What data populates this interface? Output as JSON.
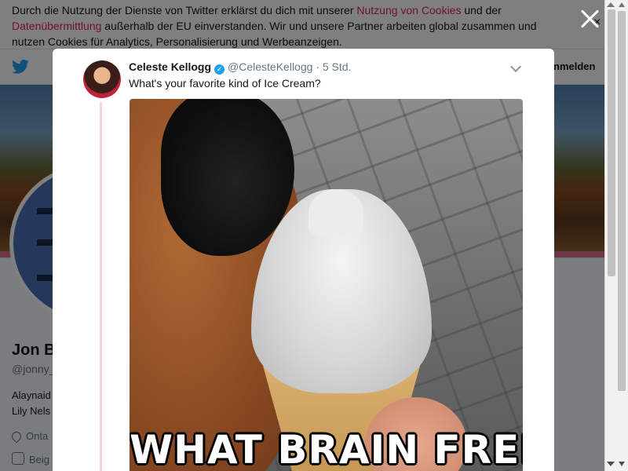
{
  "cookie_banner": {
    "text_1": "Durch die Nutzung der Dienste von Twitter erklärst du dich mit unserer ",
    "link_1": "Nutzung von Cookies",
    "text_2": " und der ",
    "link_2": "Datenübermittlung",
    "text_3": " außerhalb der EU einverstanden. Wir und unsere Partner arbeiten global zusammen und nutzen Cookies für Analytics, Personalisierung und Werbeanzeigen.",
    "close": "×"
  },
  "nav": {
    "logo_icon": "twitter-bird-icon",
    "login_label": "nmelden"
  },
  "profile": {
    "name": "Jon B",
    "handle": "@jonny_",
    "bio_line_1": "Alaynaid",
    "bio_line_2": "Lily Nels",
    "location": "Onta",
    "joined": "Beig"
  },
  "tweet": {
    "author_name": "Celeste Kellogg",
    "verified_icon": "verified-badge-icon",
    "handle": "@CelesteKellogg",
    "separator": "·",
    "time": "5 Std.",
    "text": "What's your favorite kind of Ice Cream?",
    "media_caption": "WHAT BRAIN FREEZE",
    "more_icon": "chevron-down-icon"
  },
  "overlay": {
    "close_icon": "close-icon"
  },
  "colors": {
    "twitter_blue": "#1da1f2",
    "link_red": "#e0245e",
    "thread_line": "#fbd2de"
  }
}
